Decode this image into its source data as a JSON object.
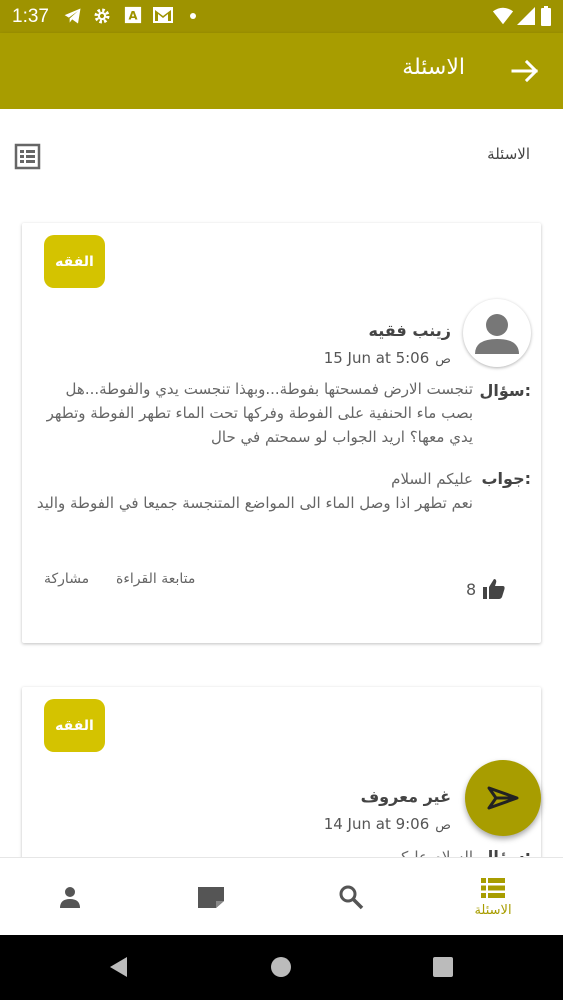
{
  "status_bar": {
    "time": "1:37",
    "icons": [
      "telegram-icon",
      "gear-icon",
      "font-a-icon",
      "gmail-icon",
      "dot-icon",
      "wifi-icon",
      "signal-icon",
      "battery-icon"
    ]
  },
  "app_bar": {
    "title": "الاسئلة",
    "back_icon": "arrow-right-icon",
    "color": "#a89d00"
  },
  "section": {
    "label": "الاسئلة",
    "icon": "list-view-icon"
  },
  "cards": [
    {
      "tag": "الفقه",
      "author": "زينب فقيه",
      "date": "15 Jun at 5:06",
      "ampm": "ص",
      "question_label": "سؤال:",
      "question": "تنجست الارض فمسحتها بفوطة...وبهذا تنجست يدي والفوطة...هل بصب ماء الحنفية على الفوطة وفركها تحت الماء تطهر الفوطة وتطهر يدي معها؟ اريد الجواب لو سمحتم في حال",
      "answer_label": "جواب:",
      "answer_line1": "عليكم السلام",
      "answer_line2": "نعم تطهر اذا وصل الماء الى المواضع المتنجسة جميعا في الفوطة واليد",
      "likes": "8",
      "follow": "متابعة القراءة",
      "share": "مشاركة"
    },
    {
      "tag": "الفقه",
      "author": "غير معروف",
      "date": "14 Jun at 9:06",
      "ampm": "ص",
      "question_label": "سؤال:",
      "question": "السلام عليكم"
    }
  ],
  "fab": {
    "icon": "send-icon"
  },
  "bottom_nav": [
    {
      "name": "profile",
      "icon": "person-icon",
      "label": ""
    },
    {
      "name": "articles",
      "icon": "note-icon",
      "label": ""
    },
    {
      "name": "search",
      "icon": "search-icon",
      "label": ""
    },
    {
      "name": "questions",
      "icon": "list-icon",
      "label": "الاسئلة",
      "active": true
    }
  ],
  "colors": {
    "accent": "#a89d00",
    "tag": "#d4c300",
    "status_bar": "#9e9300"
  }
}
